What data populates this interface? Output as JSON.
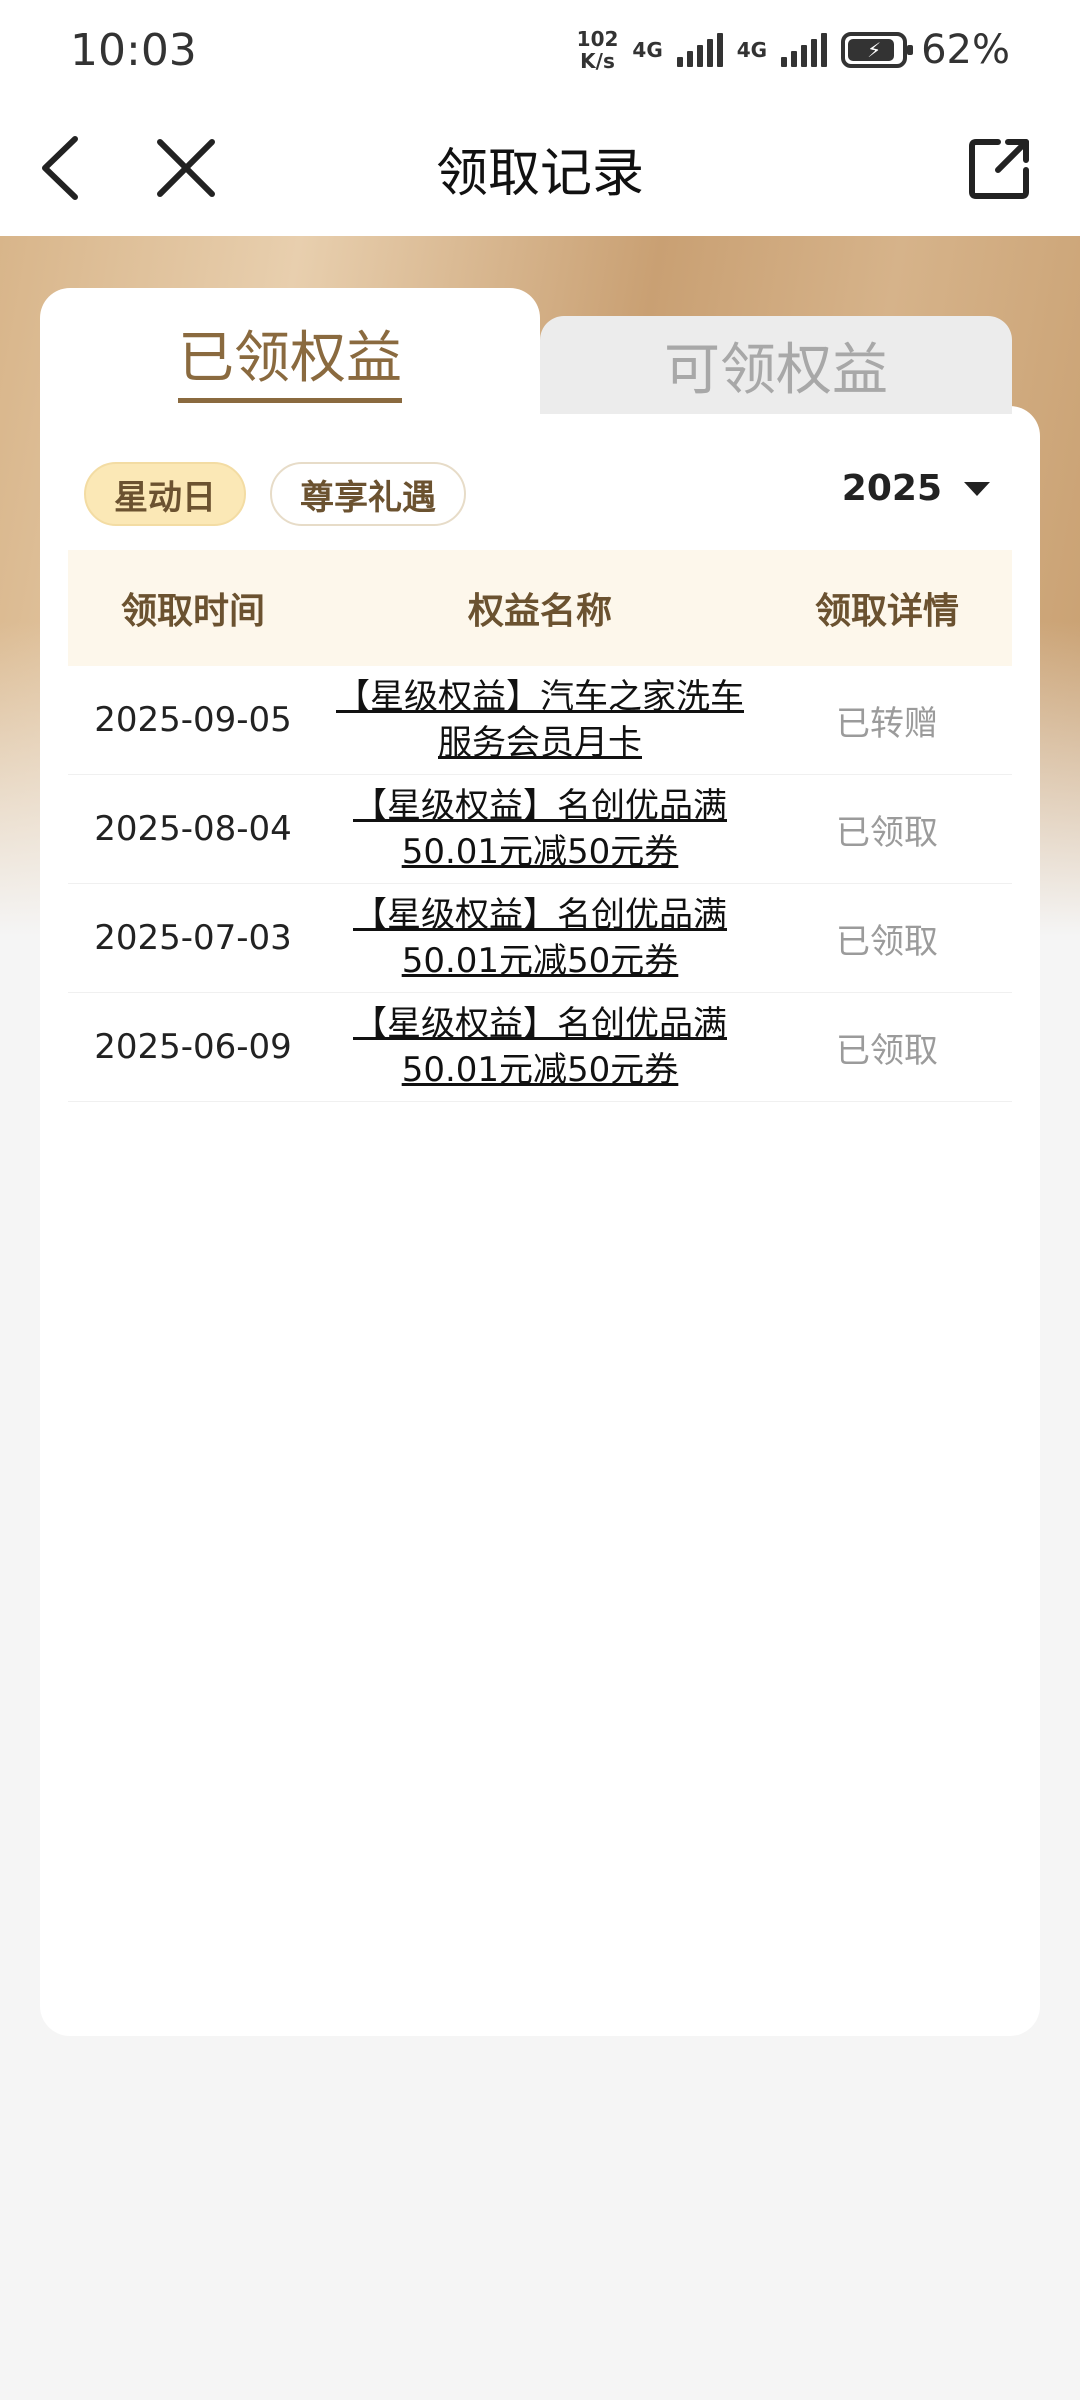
{
  "status_bar": {
    "time": "10:03",
    "net_speed_value": "102",
    "net_speed_unit": "K/s",
    "net_label_1": "4G",
    "net_label_2": "4G",
    "battery_percent": "62%"
  },
  "nav": {
    "title": "领取记录",
    "back_icon": "chevron-left-icon",
    "close_icon": "close-icon",
    "share_icon": "share-icon"
  },
  "tabs": [
    {
      "label": "已领权益",
      "active": true
    },
    {
      "label": "可领权益",
      "active": false
    }
  ],
  "filters": [
    {
      "label": "星动日",
      "active": true
    },
    {
      "label": "尊享礼遇",
      "active": false
    }
  ],
  "year_select": {
    "value": "2025"
  },
  "table": {
    "headers": {
      "time": "领取时间",
      "name": "权益名称",
      "detail": "领取详情"
    },
    "rows": [
      {
        "time": "2025-09-05",
        "name": "【星级权益】汽车之家洗车服务会员月卡",
        "detail": "已转赠"
      },
      {
        "time": "2025-08-04",
        "name": "【星级权益】名创优品满50.01元减50元券",
        "detail": "已领取"
      },
      {
        "time": "2025-07-03",
        "name": "【星级权益】名创优品满50.01元减50元券",
        "detail": "已领取"
      },
      {
        "time": "2025-06-09",
        "name": "【星级权益】名创优品满50.01元减50元券",
        "detail": "已领取"
      }
    ]
  },
  "colors": {
    "accent_gold": "#8a6a3f",
    "chip_active_bg": "#fbe8b6",
    "header_bg": "#fdf7eb"
  }
}
